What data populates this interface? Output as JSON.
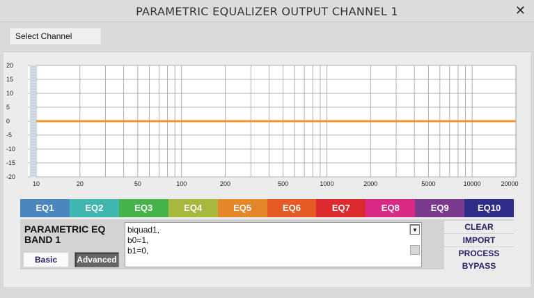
{
  "window": {
    "title": "PARAMETRIC EQUALIZER OUTPUT CHANNEL 1",
    "close_symbol": "✕"
  },
  "select_channel_label": "Select Channel",
  "chart_data": {
    "type": "line",
    "y_ticks": [
      "20",
      "15",
      "10",
      "5",
      "0",
      "-5",
      "-10",
      "-15",
      "-20"
    ],
    "x_ticks": [
      "10",
      "20",
      "50",
      "100",
      "200",
      "500",
      "1000",
      "2000",
      "5000",
      "10000",
      "20000"
    ],
    "ylim": [
      -20,
      20
    ],
    "xlim": [
      10,
      20000
    ],
    "x_scale": "log",
    "grid": true,
    "series": [
      {
        "color": "#f0962a",
        "x": [
          10,
          20000
        ],
        "y": [
          0,
          0
        ]
      }
    ]
  },
  "tabs": [
    {
      "label": "EQ1",
      "color": "#4a86c0"
    },
    {
      "label": "EQ2",
      "color": "#3fb6b0"
    },
    {
      "label": "EQ3",
      "color": "#45b24a"
    },
    {
      "label": "EQ4",
      "color": "#a8b83c"
    },
    {
      "label": "EQ5",
      "color": "#e6862a"
    },
    {
      "label": "EQ6",
      "color": "#e65a24"
    },
    {
      "label": "EQ7",
      "color": "#dd2a2f"
    },
    {
      "label": "EQ8",
      "color": "#d92b85"
    },
    {
      "label": "EQ9",
      "color": "#7a3a8e"
    },
    {
      "label": "EQ10",
      "color": "#2f2d8a"
    }
  ],
  "band": {
    "title": "PARAMETRIC EQ BAND 1",
    "basic_label": "Basic",
    "advanced_label": "Advanced"
  },
  "code_lines": [
    "biquad1,",
    "b0=1,",
    "b1=0,"
  ],
  "actions": {
    "clear": "CLEAR",
    "import": "IMPORT",
    "process": "PROCESS",
    "bypass": "BYPASS"
  }
}
